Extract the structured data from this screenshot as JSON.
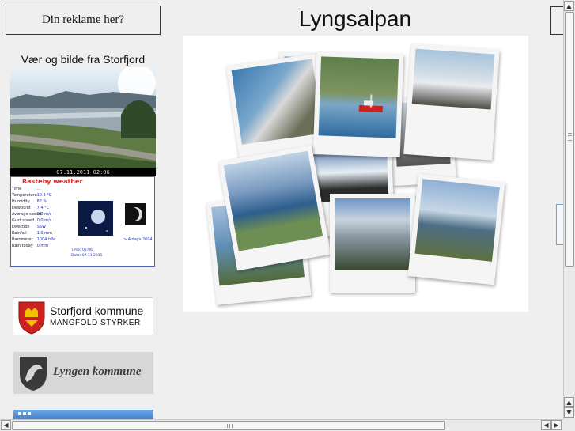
{
  "sidebar": {
    "ad_label": "Din reklame her?",
    "webcam_title": "Vær og bilde fra Storfjord",
    "webcam_timestamp": "07.11.2011 02:06",
    "weather": {
      "title": "Rasteby weather",
      "rows": [
        {
          "label": "Time",
          "value": "..."
        },
        {
          "label": "Temperature",
          "value": "10.3 °C"
        },
        {
          "label": "Humidity",
          "value": "82 %"
        },
        {
          "label": "Dewpoint",
          "value": "7.4 °C"
        },
        {
          "label": "Average speed",
          "value": "0.0 m/s"
        },
        {
          "label": "Gust speed",
          "value": "0.0 m/s"
        },
        {
          "label": "Direction",
          "value": "SSW"
        },
        {
          "label": "Rainfall",
          "value": "1.0 mm"
        },
        {
          "label": "Barometer",
          "value": "1004 hPa"
        },
        {
          "label": "Rain today",
          "value": "0 mm"
        }
      ],
      "moon_link": "> 4 days 2694",
      "footer_line1": "Time: 02:06",
      "footer_line2": "Date: 07.11.2011"
    },
    "logo1": {
      "name": "Storfjord kommune",
      "tagline": "MANGFOLD STYRKER"
    },
    "logo2": {
      "name": "Lyngen kommune"
    }
  },
  "main": {
    "title": "Lyngsalpan"
  },
  "colors": {
    "background": "#efefef",
    "webcam_sky": "#c8d8e4",
    "weather_title": "#dd2222",
    "logo_shield": "#cc2222"
  }
}
